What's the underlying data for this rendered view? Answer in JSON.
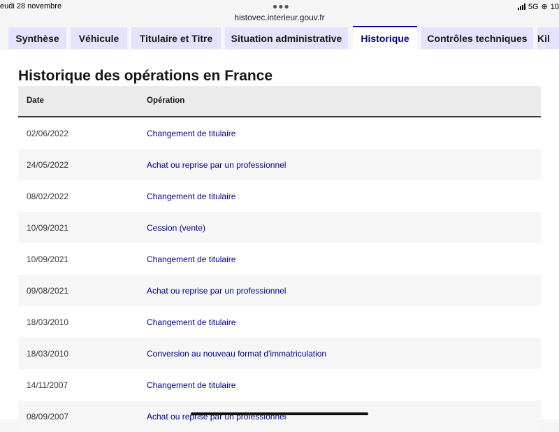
{
  "status": {
    "date": "eudi 28 novembre",
    "network": "5G",
    "battery_partial": "10",
    "url": "histovec.interieur.gouv.fr"
  },
  "tabs": [
    {
      "label": "Synthèse",
      "active": false
    },
    {
      "label": "Véhicule",
      "active": false
    },
    {
      "label": "Titulaire et Titre",
      "active": false
    },
    {
      "label": "Situation administrative",
      "active": false
    },
    {
      "label": "Historique",
      "active": true
    },
    {
      "label": "Contrôles techniques",
      "active": false
    },
    {
      "label": "Kil",
      "active": false
    }
  ],
  "section": {
    "title": "Historique des opérations en France"
  },
  "table": {
    "headers": [
      "Date",
      "Opération"
    ],
    "rows": [
      {
        "date": "02/06/2022",
        "operation": "Changement de titulaire"
      },
      {
        "date": "24/05/2022",
        "operation": "Achat ou reprise par un professionnel"
      },
      {
        "date": "08/02/2022",
        "operation": "Changement de titulaire"
      },
      {
        "date": "10/09/2021",
        "operation": "Cession (vente)"
      },
      {
        "date": "10/09/2021",
        "operation": "Changement de titulaire"
      },
      {
        "date": "09/08/2021",
        "operation": "Achat ou reprise par un professionnel"
      },
      {
        "date": "18/03/2010",
        "operation": "Changement de titulaire"
      },
      {
        "date": "18/03/2010",
        "operation": "Conversion au nouveau format d'immatriculation"
      },
      {
        "date": "14/11/2007",
        "operation": "Changement de titulaire"
      },
      {
        "date": "08/09/2007",
        "operation": "Achat ou reprise par un professionnel"
      }
    ]
  },
  "colors": {
    "accent": "#000091",
    "tab_bg": "#e3e3fd",
    "row_alt": "#f6f6f6"
  }
}
